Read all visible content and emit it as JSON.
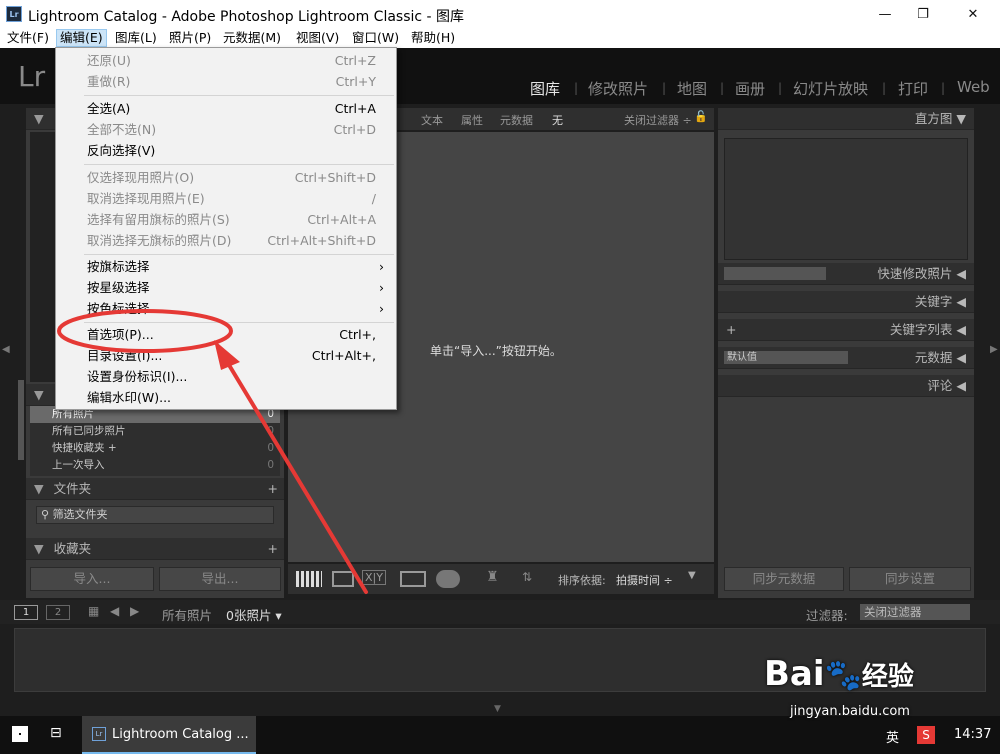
{
  "window": {
    "title": "Lightroom Catalog - Adobe Photoshop Lightroom Classic - 图库",
    "app_badge": "Lr",
    "min": "—",
    "max": "❐",
    "close": "✕"
  },
  "menubar": [
    "文件(F)",
    "编辑(E)",
    "图库(L)",
    "照片(P)",
    "元数据(M)",
    "视图(V)",
    "窗口(W)",
    "帮助(H)"
  ],
  "identity": {
    "logo": "Lr",
    "modules": [
      "图库",
      "修改照片",
      "地图",
      "画册",
      "幻灯片放映",
      "打印",
      "Web"
    ],
    "active": "图库"
  },
  "filter_bar": {
    "items": [
      "文本",
      "属性",
      "元数据",
      "无"
    ],
    "preset": "关闭过滤器 ÷"
  },
  "left_panel": {
    "catalog_rows": [
      {
        "label": "所有照片",
        "count": "0"
      },
      {
        "label": "所有已同步照片",
        "count": "0"
      },
      {
        "label": "快捷收藏夹 +",
        "count": "0"
      },
      {
        "label": "上一次导入",
        "count": "0"
      }
    ],
    "folders_header": "文件夹",
    "folder_filter": "筛选文件夹",
    "collections_header": "收藏夹",
    "import_btn": "导入...",
    "export_btn": "导出..."
  },
  "center": {
    "empty_message": "单击“导入...”按钮开始。"
  },
  "toolbar": {
    "sort_label": "排序依据:",
    "sort_value": "拍摄时间 ÷",
    "compare": "X|Y"
  },
  "right_panel": {
    "histogram": "直方图",
    "quick_develop": "快速修改照片",
    "keywording": "关键字",
    "keyword_list": "关键字列表",
    "metadata": "元数据",
    "metadata_preset": "默认值",
    "comments": "评论",
    "sync_metadata": "同步元数据",
    "sync_settings": "同步设置"
  },
  "filmstrip": {
    "screen1": "1",
    "screen2": "2",
    "source": "所有照片",
    "count": "0张照片 ▾",
    "filter_label": "过滤器:",
    "filter_value": "关闭过滤器"
  },
  "edit_menu": {
    "items": [
      {
        "label": "还原(U)",
        "shortcut": "Ctrl+Z",
        "disabled": true
      },
      {
        "label": "重做(R)",
        "shortcut": "Ctrl+Y",
        "disabled": true
      },
      {
        "label": "全选(A)",
        "shortcut": "Ctrl+A",
        "disabled": false
      },
      {
        "label": "全部不选(N)",
        "shortcut": "Ctrl+D",
        "disabled": true
      },
      {
        "label": "反向选择(V)",
        "shortcut": "",
        "disabled": false
      },
      {
        "label": "仅选择现用照片(O)",
        "shortcut": "Ctrl+Shift+D",
        "disabled": true
      },
      {
        "label": "取消选择现用照片(E)",
        "shortcut": "/",
        "disabled": true
      },
      {
        "label": "选择有留用旗标的照片(S)",
        "shortcut": "Ctrl+Alt+A",
        "disabled": true
      },
      {
        "label": "取消选择无旗标的照片(D)",
        "shortcut": "Ctrl+Alt+Shift+D",
        "disabled": true
      },
      {
        "label": "按旗标选择",
        "shortcut": "›",
        "disabled": false
      },
      {
        "label": "按星级选择",
        "shortcut": "›",
        "disabled": false
      },
      {
        "label": "按色标选择",
        "shortcut": "›",
        "disabled": false
      },
      {
        "label": "首选项(P)...",
        "shortcut": "Ctrl+,",
        "disabled": false
      },
      {
        "label": "目录设置(I)...",
        "shortcut": "Ctrl+Alt+,",
        "disabled": false
      },
      {
        "label": "设置身份标识(I)...",
        "shortcut": "",
        "disabled": false
      },
      {
        "label": "编辑水印(W)...",
        "shortcut": "",
        "disabled": false
      }
    ]
  },
  "taskbar": {
    "app_label": "Lightroom Catalog ...",
    "ime": "英",
    "time": "14:37"
  },
  "watermark": {
    "brand": "Bai",
    "brand2": "经验",
    "url": "jingyan.baidu.com"
  },
  "colors": {
    "accent_red": "#e53935",
    "menu_highlight": "#cce4f7"
  }
}
